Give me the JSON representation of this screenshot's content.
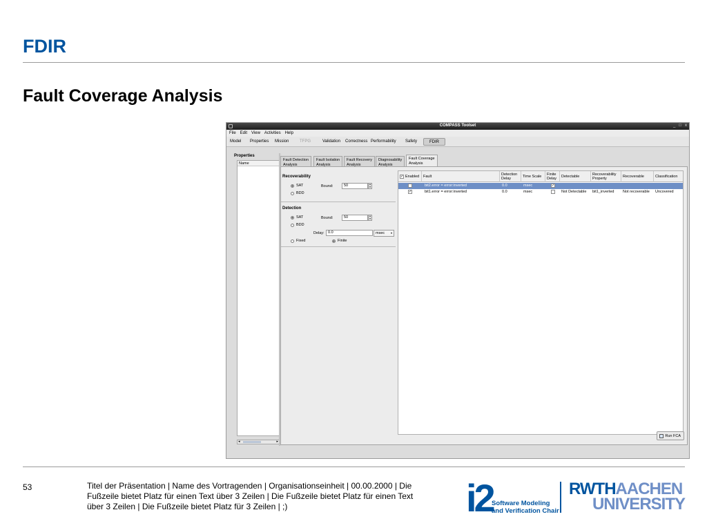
{
  "slide": {
    "title": "FDIR",
    "subtitle": "Fault Coverage Analysis",
    "page_number": "53",
    "footer_text": "Titel der Präsentation  |  Name des Vortragenden  |  Organisationseinheit  |  00.00.2000  |  Die Fußzeile bietet Platz für einen Text über 3 Zeilen  |  Die Fußzeile bietet Platz für einen Text über 3 Zeilen  |  Die Fußzeile bietet Platz für 3 Zeilen  | ;)",
    "logo_chair": {
      "number": "i2",
      "line1": "Software Modeling",
      "line2": "and Verification Chair"
    },
    "logo_university": {
      "line1_a": "RWTH",
      "line1_b": "AACHEN",
      "line2": "UNIVERSITY"
    },
    "colors": {
      "brand_blue": "#00549f",
      "light_blue": "#6f8fc7"
    }
  },
  "app": {
    "window_title": "COMPASS Toolset",
    "window_controls": [
      "_",
      "□",
      "x"
    ],
    "menu": [
      "File",
      "Edit",
      "View",
      "Activities",
      "Help"
    ],
    "toolbar": {
      "model": "Model",
      "properties": "Properties",
      "mission": "Mission",
      "tfpg": "TFPG",
      "validation": "Validation",
      "correctness": "Correctness",
      "performability": "Performability",
      "safety": "Safety",
      "fdir": "FDIR"
    },
    "properties_panel": {
      "title": "Properties",
      "column": "Name"
    },
    "tabs": {
      "fda_1": "Fault Detection",
      "fda_2": "Analysis",
      "fia_1": "Fault Isolation",
      "fia_2": "Analysis",
      "fra_1": "Fault Recovery",
      "fra_2": "Analysis",
      "da_1": "Diagnosability",
      "da_2": "Analysis",
      "fca_1": "Fault Coverage",
      "fca_2": "Analysis"
    },
    "settings": {
      "recoverability": {
        "title": "Recoverability",
        "opt_sat": "SAT",
        "opt_bdd": "BDD",
        "selected": "SAT",
        "bound_label": "Bound:",
        "bound_value": "50"
      },
      "detection": {
        "title": "Detection",
        "opt_sat": "SAT",
        "opt_bdd": "BDD",
        "selected": "SAT",
        "bound_label": "Bound:",
        "bound_value": "50",
        "delay_label": "Delay:",
        "delay_value": "0.0",
        "delay_unit": "msec",
        "opt_fixed": "Fixed",
        "opt_finite": "Finite",
        "delay_mode": "Finite"
      }
    },
    "results": {
      "headers": {
        "enabled": "Enabled",
        "fault": "Fault",
        "detection_delay_1": "Detection",
        "detection_delay_2": "Delay",
        "time_scale": "Time Scale",
        "finite_delay_1": "Finite",
        "finite_delay_2": "Delay",
        "detectable": "Detectable",
        "recoverability_1": "Recoverability",
        "recoverability_2": "Property",
        "recoverable": "Recoverable",
        "classification": "Classification"
      },
      "header_enabled_checked": true,
      "rows": [
        {
          "enabled": "",
          "fault": "bit2.error = error:inverted",
          "delay": "0.0",
          "scale": "msec",
          "finite": "✓",
          "detectable": "",
          "property": "",
          "recoverable": "",
          "classification": "",
          "selected": true
        },
        {
          "enabled": "✓",
          "fault": "bit1.error = error:inverted",
          "delay": "0.0",
          "scale": "msec",
          "finite": "",
          "detectable": "Not Detectable",
          "property": "bit1_inverted",
          "recoverable": "Not recoverable",
          "classification": "Uncovered",
          "selected": false
        }
      ],
      "run_button": "Run FCA"
    }
  }
}
